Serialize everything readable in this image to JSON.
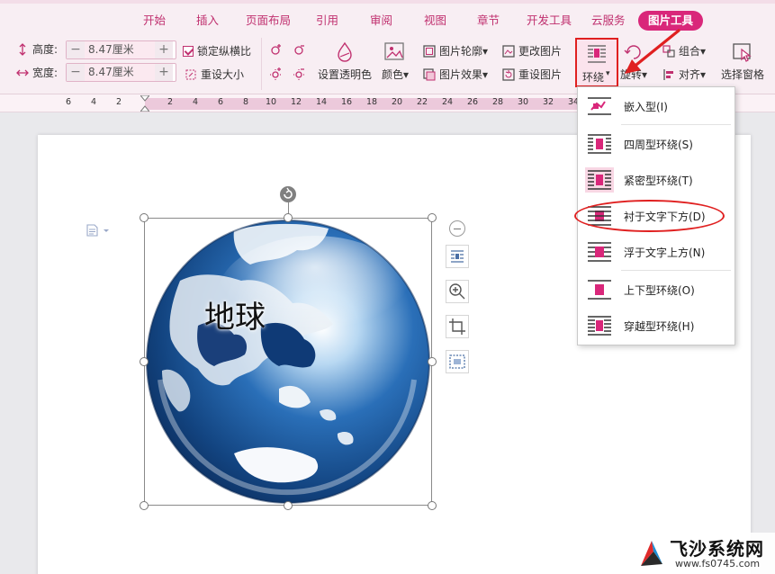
{
  "menu": {
    "tabs": [
      {
        "label": "开始"
      },
      {
        "label": "插入"
      },
      {
        "label": "页面布局"
      },
      {
        "label": "引用"
      },
      {
        "label": "审阅"
      },
      {
        "label": "视图"
      },
      {
        "label": "章节"
      },
      {
        "label": "开发工具"
      },
      {
        "label": "云服务"
      },
      {
        "label": "图片工具",
        "active": true
      }
    ]
  },
  "toolbar": {
    "height_label": "高度:",
    "height_value": "8.47厘米",
    "width_label": "宽度:",
    "width_value": "8.47厘米",
    "minus": "−",
    "plus": "+",
    "lock_ratio": "锁定纵横比",
    "reset_size": "重设大小",
    "set_transparent": "设置透明色",
    "color": "颜色",
    "picture_outline": "图片轮廓",
    "picture_effect": "图片效果",
    "change_picture": "更改图片",
    "reset_picture": "重设图片",
    "wrap": "环绕",
    "rotate": "旋转",
    "group": "组合",
    "align": "对齐",
    "selection_pane": "选择窗格",
    "dropdown_arrow": "▾"
  },
  "ruler": {
    "numbers": [
      "6",
      "4",
      "2",
      "2",
      "4",
      "6",
      "8",
      "10",
      "12",
      "14",
      "16",
      "18",
      "20",
      "22",
      "24",
      "26",
      "28",
      "30",
      "32",
      "34"
    ]
  },
  "document": {
    "image_text": "地球"
  },
  "wrap_menu": {
    "items": [
      {
        "label": "嵌入型(I)",
        "icon": "inline-wrap-icon"
      },
      {
        "label": "四周型环绕(S)",
        "icon": "square-wrap-icon"
      },
      {
        "label": "紧密型环绕(T)",
        "icon": "tight-wrap-icon"
      },
      {
        "label": "衬于文字下方(D)",
        "icon": "behind-text-icon"
      },
      {
        "label": "浮于文字上方(N)",
        "icon": "in-front-of-text-icon"
      },
      {
        "label": "上下型环绕(O)",
        "icon": "top-bottom-wrap-icon"
      },
      {
        "label": "穿越型环绕(H)",
        "icon": "through-wrap-icon"
      }
    ]
  },
  "watermark": {
    "title": "飞沙系统网",
    "url": "www.fs0745.com"
  },
  "colors": {
    "accent": "#d9277a",
    "annotation_red": "#e02020",
    "ribbon_bg": "#f8eef3"
  }
}
